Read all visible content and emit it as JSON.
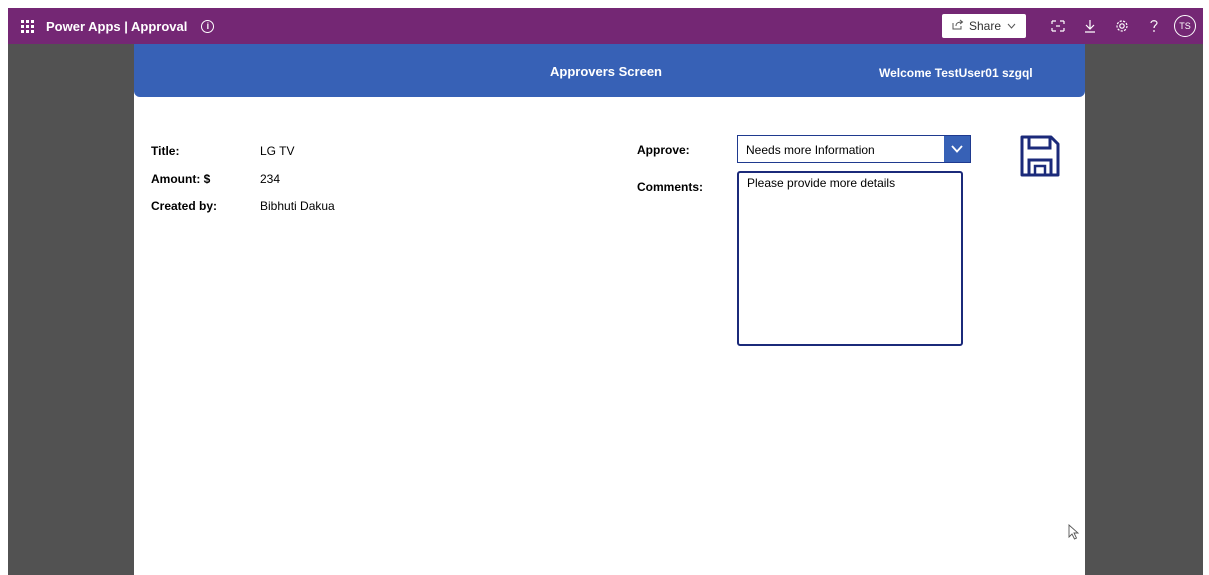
{
  "topbar": {
    "app_title": "Power Apps  |  Approval",
    "info_icon": "i",
    "share_label": "Share",
    "avatar_initials": "TS",
    "icons": [
      "waffle-icon",
      "info-icon",
      "share-icon",
      "chevron-down-icon",
      "fit-screen-icon",
      "download-icon",
      "settings-icon",
      "help-icon"
    ]
  },
  "header": {
    "title": "Approvers Screen",
    "welcome": "Welcome TestUser01 szgql"
  },
  "details": {
    "title_label": "Title:",
    "title_value": "LG TV",
    "amount_label": "Amount: $",
    "amount_value": "234",
    "created_label": "Created by:",
    "created_value": "Bibhuti Dakua"
  },
  "approval": {
    "approve_label": "Approve:",
    "approve_value": "Needs more Information",
    "comments_label": "Comments:",
    "comments_value": "Please provide more details"
  },
  "colors": {
    "topbar": "#742774",
    "header": "#3761b6",
    "gutter": "#525252",
    "accent_dark": "#1b2a7a"
  }
}
